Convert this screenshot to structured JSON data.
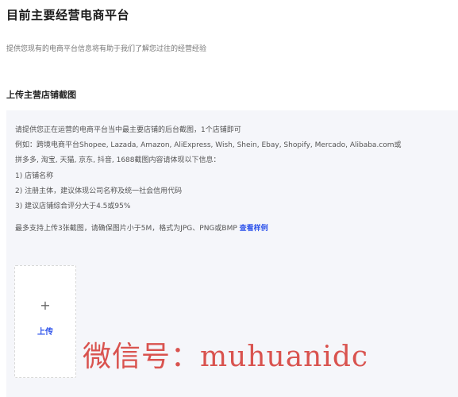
{
  "page": {
    "title": "目前主要经营电商平台",
    "subtitle": "提供您现有的电商平台信息将有助于我们了解您过往的经营经验"
  },
  "section": {
    "title": "上传主营店铺截图"
  },
  "instructions": {
    "line1": "请提供您正在运营的电商平台当中最主要店铺的后台截图，1个店铺即可",
    "line2": "例如：跨境电商平台Shopee, Lazada, Amazon, AliExpress, Wish, Shein, Ebay, Shopify, Mercado, Alibaba.com或",
    "line3": "拼多多, 淘宝, 天猫, 京东, 抖音, 1688截图内容请体现以下信息：",
    "item1": "1) 店铺名称",
    "item2": "2) 注册主体，建议体现公司名称及统一社会信用代码",
    "item3": "3) 建议店铺综合评分大于4.5或95%",
    "upload_limit": "最多支持上传3张截图，请确保图片小于5M，格式为JPG、PNG或BMP ",
    "sample_link": "查看样例"
  },
  "upload": {
    "plus_glyph": "+",
    "label": "上传"
  },
  "watermark": {
    "text": "微信号：muhuanidc"
  }
}
